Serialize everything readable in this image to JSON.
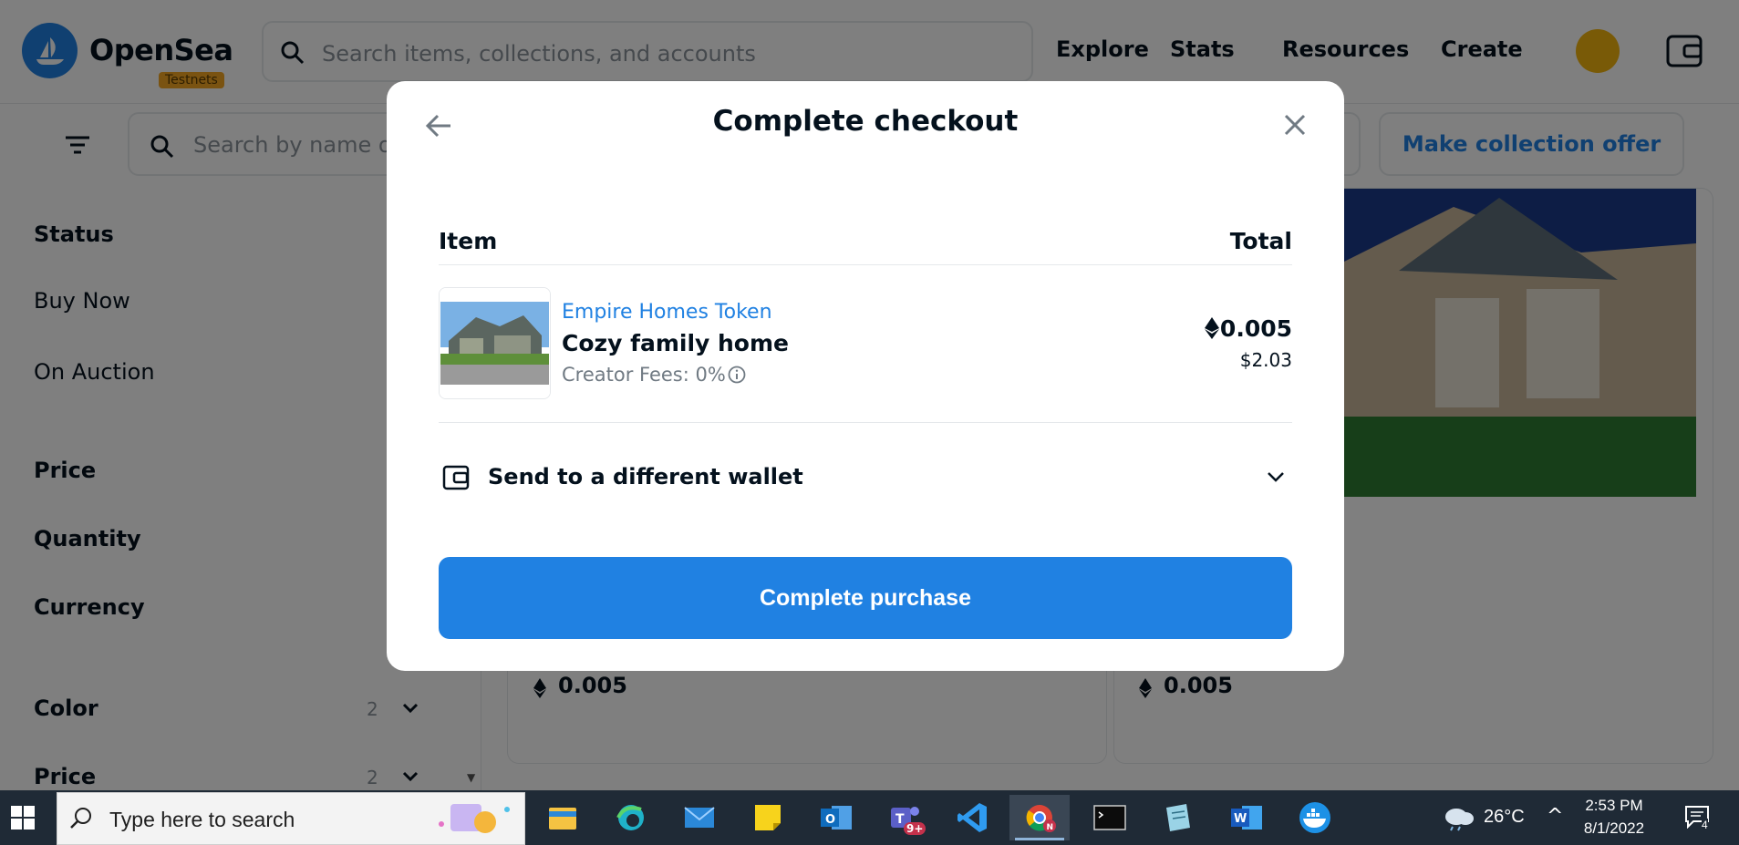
{
  "header": {
    "logo_text": "OpenSea",
    "testnets_badge": "Testnets",
    "search_placeholder": "Search items, collections, and accounts",
    "nav": [
      "Explore",
      "Stats",
      "Resources",
      "Create"
    ]
  },
  "subbar": {
    "search_placeholder": "Search by name or attribute",
    "collection_offer_label": "Make collection offer"
  },
  "sidebar": {
    "status_label": "Status",
    "buy_now": "Buy Now",
    "on_auction": "On Auction",
    "price_label": "Price",
    "quantity_label": "Quantity",
    "currency_label": "Currency",
    "color_label": "Color",
    "color_count": "2",
    "price2_label": "Price",
    "price2_count": "2"
  },
  "cards": [
    {
      "price": "0.005"
    },
    {
      "price": "0.005"
    }
  ],
  "modal": {
    "title": "Complete checkout",
    "item_header": "Item",
    "total_header": "Total",
    "item": {
      "collection": "Empire Homes Token",
      "name": "Cozy family home",
      "creator_fees": "Creator Fees: 0%",
      "price_eth": "0.005",
      "price_usd": "$2.03"
    },
    "send_wallet_label": "Send to a different wallet",
    "purchase_button": "Complete purchase"
  },
  "taskbar": {
    "search_placeholder": "Type here to search",
    "apps": [
      "file-explorer",
      "edge",
      "mail",
      "sticky-notes",
      "outlook",
      "teams",
      "vscode",
      "chrome",
      "terminal",
      "notepad",
      "word",
      "docker"
    ],
    "teams_badge": "9+",
    "temperature": "26°C",
    "time": "2:53 PM",
    "date": "8/1/2022",
    "notification_count": "4"
  },
  "colors": {
    "accent": "#2081e2",
    "text": "#04111d",
    "taskbar": "#1f2a36"
  }
}
